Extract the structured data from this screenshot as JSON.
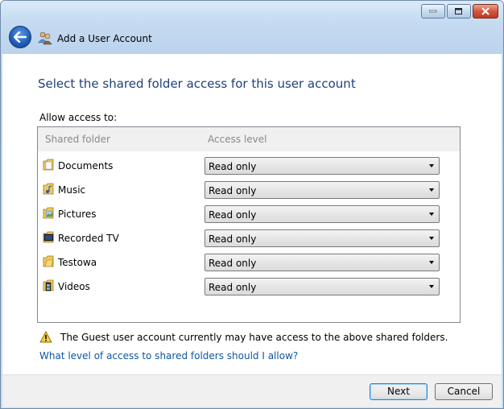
{
  "window": {
    "title": "Add a User Account"
  },
  "main": {
    "heading": "Select the shared folder access for this user account",
    "allow_label": "Allow access to:",
    "columns": {
      "folder": "Shared folder",
      "access": "Access level"
    },
    "rows": [
      {
        "name": "Documents",
        "access": "Read only",
        "icon": "documents-folder-icon"
      },
      {
        "name": "Music",
        "access": "Read only",
        "icon": "music-folder-icon"
      },
      {
        "name": "Pictures",
        "access": "Read only",
        "icon": "pictures-folder-icon"
      },
      {
        "name": "Recorded TV",
        "access": "Read only",
        "icon": "recorded-tv-folder-icon"
      },
      {
        "name": "Testowa",
        "access": "Read only",
        "icon": "folder-icon"
      },
      {
        "name": "Videos",
        "access": "Read only",
        "icon": "videos-folder-icon"
      }
    ],
    "warning": "The Guest user account currently may have access to the above shared folders.",
    "help_link": "What level of access to shared folders should I allow?"
  },
  "footer": {
    "next_label": "Next",
    "cancel_label": "Cancel"
  },
  "colors": {
    "heading": "#1f3f7a",
    "link": "#0d56a6",
    "chrome": "#bad3ec",
    "close": "#c23a1f"
  }
}
